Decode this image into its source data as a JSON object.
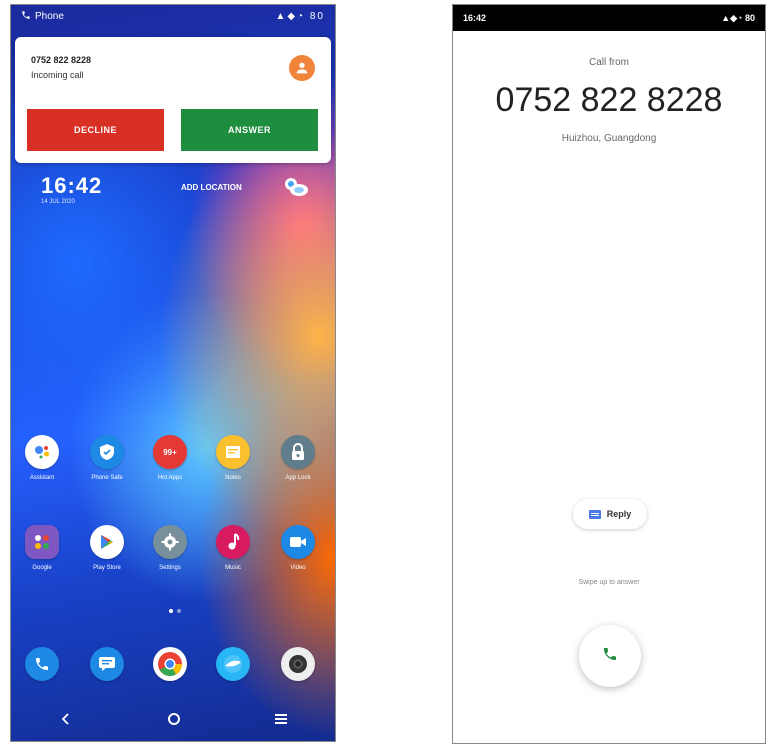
{
  "left_phone": {
    "status_bar": {
      "app_name": "Phone",
      "indicators": "▲◆◔ 80"
    },
    "notification": {
      "number": "0752 822 8228",
      "subtitle": "Incoming call",
      "decline_label": "DECLINE",
      "answer_label": "ANSWER"
    },
    "widget": {
      "time": "16:42",
      "date": "14 JUL 2020",
      "add_location": "ADD LOCATION"
    },
    "apps_row1": [
      {
        "label": "Assistant",
        "icon": "assistant-icon",
        "color": "#ffffff"
      },
      {
        "label": "Phone Safe",
        "icon": "shield-icon",
        "color": "#1e88e5"
      },
      {
        "label": "Hot Apps",
        "icon": "hot-apps-icon",
        "color": "#e53935"
      },
      {
        "label": "Notes",
        "icon": "notes-icon",
        "color": "#fbc02d"
      },
      {
        "label": "App Lock",
        "icon": "lock-icon",
        "color": "#607d8b"
      }
    ],
    "apps_row2": [
      {
        "label": "Google",
        "icon": "google-folder-icon",
        "color": "#7e57c2"
      },
      {
        "label": "Play Store",
        "icon": "play-store-icon",
        "color": "#ffffff"
      },
      {
        "label": "Settings",
        "icon": "settings-icon",
        "color": "#78909c"
      },
      {
        "label": "Music",
        "icon": "music-icon",
        "color": "#d81b60"
      },
      {
        "label": "Video",
        "icon": "video-icon",
        "color": "#1e88e5"
      }
    ],
    "dock": [
      {
        "icon": "phone-icon",
        "color": "#1e88e5"
      },
      {
        "icon": "messages-icon",
        "color": "#1e88e5"
      },
      {
        "icon": "chrome-icon",
        "color": "#ffffff"
      },
      {
        "icon": "browser-icon",
        "color": "#29b6f6"
      },
      {
        "icon": "camera-icon",
        "color": "#eeeeee"
      }
    ],
    "nav": {
      "back": "‹",
      "home": "○",
      "menu": "≡"
    }
  },
  "right_phone": {
    "status_bar": {
      "time": "16:42",
      "indicators": "▲◆◔ 80"
    },
    "call_from": "Call from",
    "number": "0752 822 8228",
    "location": "Huizhou, Guangdong",
    "reply_label": "Reply",
    "swipe_hint": "Swipe up to answer"
  }
}
